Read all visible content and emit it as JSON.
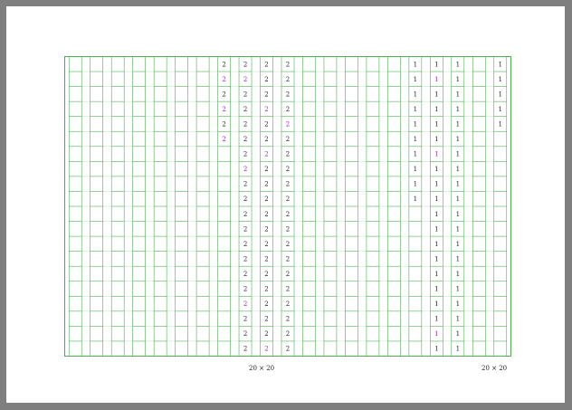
{
  "document": {
    "type": "genkou-youshi manuscript sheet",
    "layout": "two 20x20 panels side by side",
    "colors": {
      "page_background": "#7f7f7f",
      "paper": "#ffffff",
      "grid_line": "#4caf50",
      "text_dark": "#222222",
      "text_accent": "#9c27b0"
    }
  },
  "panels": [
    {
      "caption": "20 × 20",
      "cells": [
        {
          "col": 7,
          "row_start": 0,
          "row_end": 5,
          "char": "2"
        },
        {
          "col": 8,
          "row_start": 0,
          "row_end": 19,
          "char": "2"
        },
        {
          "col": 9,
          "row_start": 0,
          "row_end": 19,
          "char": "2"
        },
        {
          "col": 10,
          "row_start": 0,
          "row_end": 19,
          "char": "2"
        }
      ],
      "accent_cells": [
        {
          "col": 7,
          "row": 1
        },
        {
          "col": 7,
          "row": 3
        },
        {
          "col": 7,
          "row": 5
        },
        {
          "col": 8,
          "row": 1
        },
        {
          "col": 8,
          "row": 7
        },
        {
          "col": 8,
          "row": 16
        },
        {
          "col": 9,
          "row": 3
        },
        {
          "col": 9,
          "row": 6
        },
        {
          "col": 9,
          "row": 19
        },
        {
          "col": 10,
          "row": 4
        }
      ]
    },
    {
      "caption": "20 × 20",
      "cells": [
        {
          "col": 16,
          "row_start": 0,
          "row_end": 9,
          "char": "1"
        },
        {
          "col": 17,
          "row_start": 0,
          "row_end": 19,
          "char": "1"
        },
        {
          "col": 18,
          "row_start": 0,
          "row_end": 19,
          "char": "1"
        },
        {
          "col": 20,
          "row_start": 0,
          "row_end": 4,
          "char": "1"
        }
      ],
      "accent_cells": [
        {
          "col": 17,
          "row": 1
        },
        {
          "col": 17,
          "row": 6
        },
        {
          "col": 17,
          "row": 18
        }
      ]
    }
  ]
}
